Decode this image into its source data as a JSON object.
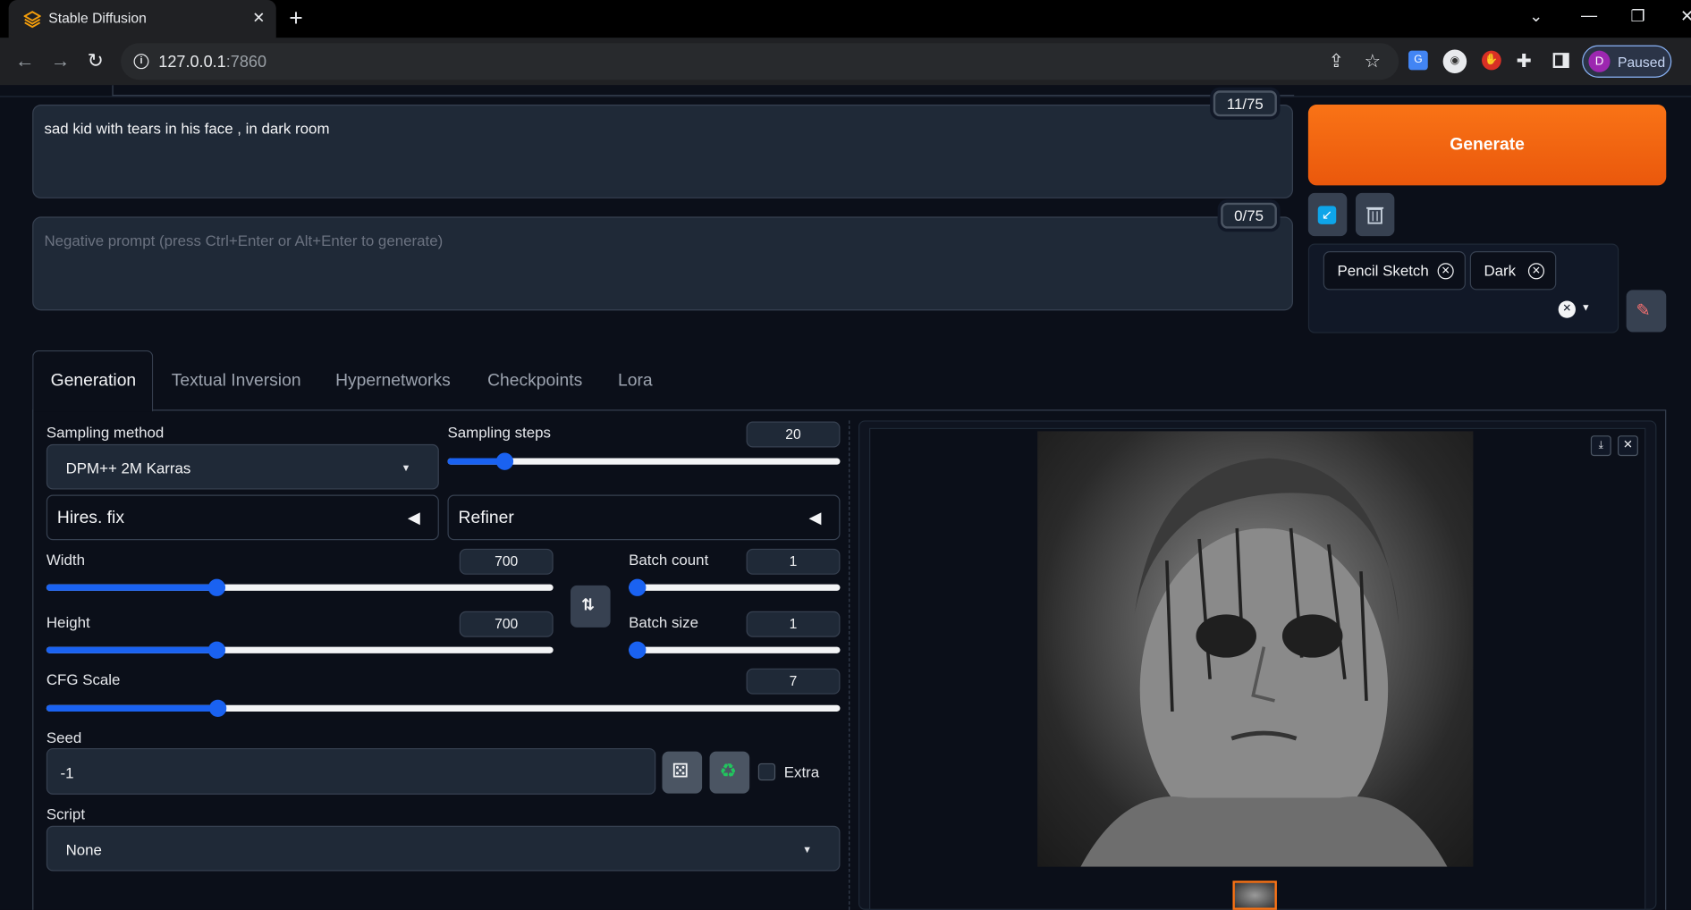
{
  "browser": {
    "tab_title": "Stable Diffusion",
    "url_host": "127.0.0.1",
    "url_port": ":7860",
    "profile_initial": "D",
    "profile_status": "Paused"
  },
  "prompt": {
    "value": "sad kid with tears in his face , in dark room",
    "token_count": "11/75"
  },
  "negative_prompt": {
    "placeholder": "Negative prompt (press Ctrl+Enter or Alt+Enter to generate)",
    "token_count": "0/75"
  },
  "generate_label": "Generate",
  "styles": {
    "selected": [
      "Pencil Sketch",
      "Dark"
    ]
  },
  "tabs": [
    "Generation",
    "Textual Inversion",
    "Hypernetworks",
    "Checkpoints",
    "Lora"
  ],
  "settings": {
    "sampling_method_label": "Sampling method",
    "sampling_method_value": "DPM++ 2M Karras",
    "sampling_steps_label": "Sampling steps",
    "sampling_steps_value": "20",
    "sampling_steps_fraction": 0.13,
    "hires_fix_label": "Hires. fix",
    "refiner_label": "Refiner",
    "width_label": "Width",
    "width_value": "700",
    "width_fraction": 0.33,
    "height_label": "Height",
    "height_value": "700",
    "height_fraction": 0.33,
    "batch_count_label": "Batch count",
    "batch_count_value": "1",
    "batch_count_fraction": 0.0,
    "batch_size_label": "Batch size",
    "batch_size_value": "1",
    "batch_size_fraction": 0.0,
    "cfg_scale_label": "CFG Scale",
    "cfg_scale_value": "7",
    "cfg_scale_fraction": 0.21,
    "seed_label": "Seed",
    "seed_value": "-1",
    "extra_label": "Extra",
    "script_label": "Script",
    "script_value": "None"
  },
  "colors": {
    "accent": "#1a62f1",
    "generate": "#f97316",
    "background": "#0b0f19"
  }
}
